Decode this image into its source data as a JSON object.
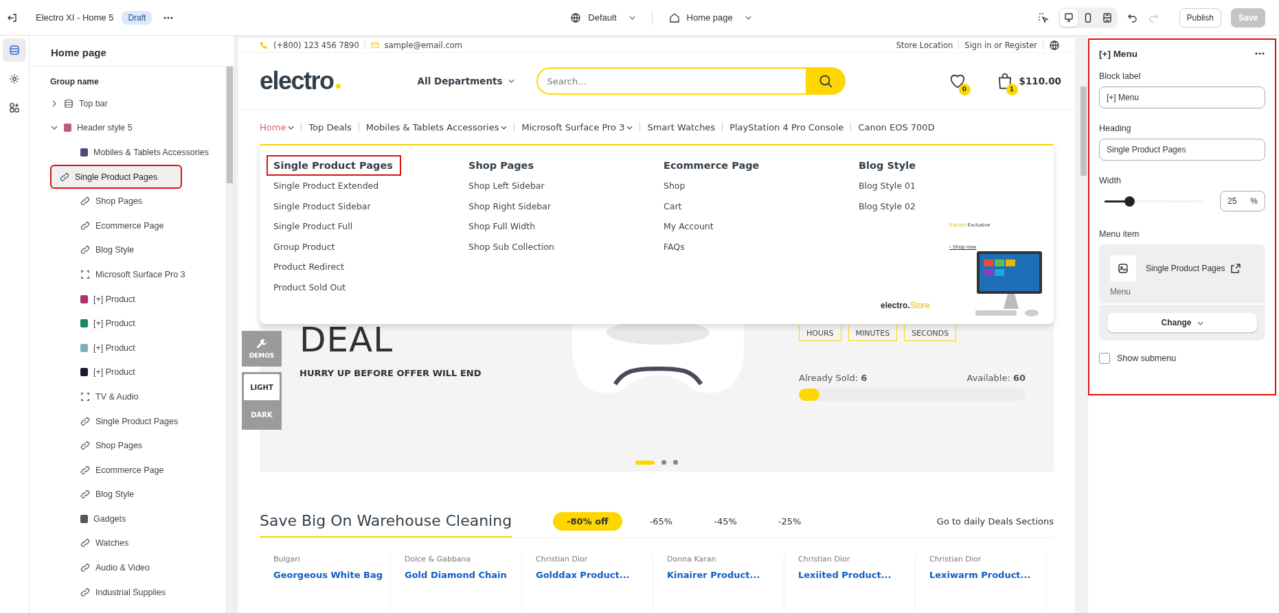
{
  "topbar": {
    "site": "Electro XI - Home 5",
    "badge": "Draft",
    "theme": "Default",
    "page": "Home page",
    "views": [
      {
        "kind": "desktop",
        "selected": true
      },
      {
        "kind": "mobile",
        "selected": false
      },
      {
        "kind": "full",
        "selected": false
      }
    ],
    "buttons": [
      {
        "label": "Publish",
        "disabled": false
      },
      {
        "label": "Save",
        "disabled": true
      }
    ]
  },
  "rail": [
    {
      "kind": "sections",
      "selected": true
    },
    {
      "kind": "settings",
      "selected": false
    },
    {
      "kind": "apps",
      "selected": false
    }
  ],
  "sidebar": {
    "title": "Home page",
    "group": "Group name",
    "items": [
      {
        "label": "Top bar",
        "kind": "section",
        "expanded": false,
        "selected": false
      },
      {
        "label": "Header style 5",
        "kind": "thumb",
        "color": "#c05a8a",
        "expanded": true,
        "selected": false,
        "children": [
          {
            "label": "Mobiles & Tablets Accessories",
            "kind": "thumb",
            "color": "#4a4a7a",
            "selected": false
          },
          {
            "label": "Single Product Pages",
            "kind": "link",
            "selected": true
          },
          {
            "label": "Shop Pages",
            "kind": "link",
            "selected": false
          },
          {
            "label": "Ecommerce Page",
            "kind": "link",
            "selected": false
          },
          {
            "label": "Blog Style",
            "kind": "link",
            "selected": false
          },
          {
            "label": "Microsoft Surface Pro 3",
            "kind": "frame",
            "selected": false
          },
          {
            "label": "[+] Product",
            "kind": "thumb",
            "color": "#b0306a",
            "selected": false
          },
          {
            "label": "[+] Product",
            "kind": "thumb",
            "color": "#1a8a5a",
            "selected": false
          },
          {
            "label": "[+] Product",
            "kind": "thumb",
            "color": "#7ab0c0",
            "selected": false
          },
          {
            "label": "[+] Product",
            "kind": "thumb",
            "color": "#1a1a2a",
            "selected": false
          },
          {
            "label": "TV & Audio",
            "kind": "frame",
            "selected": false
          },
          {
            "label": "Single Product Pages",
            "kind": "link",
            "selected": false
          },
          {
            "label": "Shop Pages",
            "kind": "link",
            "selected": false
          },
          {
            "label": "Ecommerce Page",
            "kind": "link",
            "selected": false
          },
          {
            "label": "Blog Style",
            "kind": "link",
            "selected": false
          },
          {
            "label": "Gadgets",
            "kind": "thumb",
            "color": "#555555",
            "selected": false
          },
          {
            "label": "Watches",
            "kind": "link",
            "selected": false
          },
          {
            "label": "Audio & Video",
            "kind": "link",
            "selected": false
          },
          {
            "label": "Industrial Supplies",
            "kind": "link",
            "selected": false
          }
        ]
      }
    ]
  },
  "preview": {
    "contact": [
      "(+800) 123 456 7890",
      "sample@email.com"
    ],
    "links": [
      "Store Location",
      "Sign in or Register"
    ],
    "logo": "electro",
    "departments": "All Departments",
    "search": {
      "placeholder": "Search..."
    },
    "wishlist_count": "0",
    "cart_count": "1",
    "cart_total": "$110.00",
    "nav": [
      {
        "label": "Home",
        "dropdown": true,
        "selected": true
      },
      {
        "label": "Top Deals",
        "dropdown": false,
        "selected": false
      },
      {
        "label": "Mobiles & Tablets Accessories",
        "dropdown": true,
        "selected": false
      },
      {
        "label": "Microsoft Surface Pro 3",
        "dropdown": true,
        "selected": false
      },
      {
        "label": "Smart Watches",
        "dropdown": false,
        "selected": false
      },
      {
        "label": "PlayStation 4 Pro Console",
        "dropdown": false,
        "selected": false
      },
      {
        "label": "Canon EOS 700D",
        "dropdown": false,
        "selected": false
      }
    ],
    "mega_menu": {
      "columns": [
        {
          "heading": "Single Product Pages",
          "highlighted": true,
          "links": [
            "Single Product Extended",
            "Single Product Sidebar",
            "Single Product Full",
            "Group Product",
            "Product Redirect",
            "Product Sold Out"
          ]
        },
        {
          "heading": "Shop Pages",
          "highlighted": false,
          "links": [
            "Shop Left Sidebar",
            "Shop Right Sidebar",
            "Shop Full Width",
            "Shop Sub Collection"
          ]
        },
        {
          "heading": "Ecommerce Page",
          "highlighted": false,
          "links": [
            "Shop",
            "Cart",
            "My Account",
            "FAQs"
          ]
        },
        {
          "heading": "Blog Style",
          "highlighted": false,
          "links": [
            "Blog Style 01",
            "Blog Style 02"
          ]
        }
      ],
      "promo": {
        "brand": "Electro",
        "tag": "Exclusive",
        "cta": "› Shop now",
        "store": "electro.",
        "store_suffix": "Store"
      }
    },
    "floating": {
      "demos": "DEMOS",
      "modes": [
        {
          "label": "LIGHT",
          "selected": true
        },
        {
          "label": "DARK",
          "selected": false
        }
      ]
    },
    "hero": {
      "title": "DEAL",
      "subtitle": "HURRY UP BEFORE OFFER WILL END",
      "timer": [
        "HOURS",
        "MINUTES",
        "SECONDS"
      ],
      "sold": "Already Sold: **6**",
      "available": "Available: **60**",
      "level": 0.09,
      "slides": [
        {
          "selected": true
        },
        {
          "selected": false
        },
        {
          "selected": false
        }
      ]
    },
    "deals": {
      "title": "Save Big On Warehouse Cleaning",
      "filters": [
        {
          "label": "-80% off",
          "selected": true
        },
        {
          "label": "-65%",
          "selected": false
        },
        {
          "label": "-45%",
          "selected": false
        },
        {
          "label": "-25%",
          "selected": false
        }
      ],
      "link": "Go to daily Deals Sections",
      "products": [
        {
          "brand": "Bulgari",
          "name": "Georgeous White Bag"
        },
        {
          "brand": "Dolce & Gabbana",
          "name": "Gold Diamond Chain"
        },
        {
          "brand": "Christian Dior",
          "name": "Golddax Product..."
        },
        {
          "brand": "Donna Karan",
          "name": "Kinairer Product..."
        },
        {
          "brand": "Christian Dior",
          "name": "Lexiited Product..."
        },
        {
          "brand": "Christian Dior",
          "name": "Lexiwarm Product..."
        }
      ]
    }
  },
  "panel": {
    "title": "[+] Menu",
    "highlighted": true,
    "fields": [
      {
        "label": "Block label",
        "value": "[+] Menu"
      },
      {
        "label": "Heading",
        "value": "Single Product Pages"
      }
    ],
    "width": {
      "label": "Width",
      "level": 0.25,
      "value": "25",
      "unit": "%"
    },
    "menu_item": {
      "label": "Menu item",
      "name": "Single Product Pages",
      "type": "Menu",
      "button": "Change"
    },
    "show_submenu": {
      "label": "Show submenu",
      "checked": false
    }
  }
}
